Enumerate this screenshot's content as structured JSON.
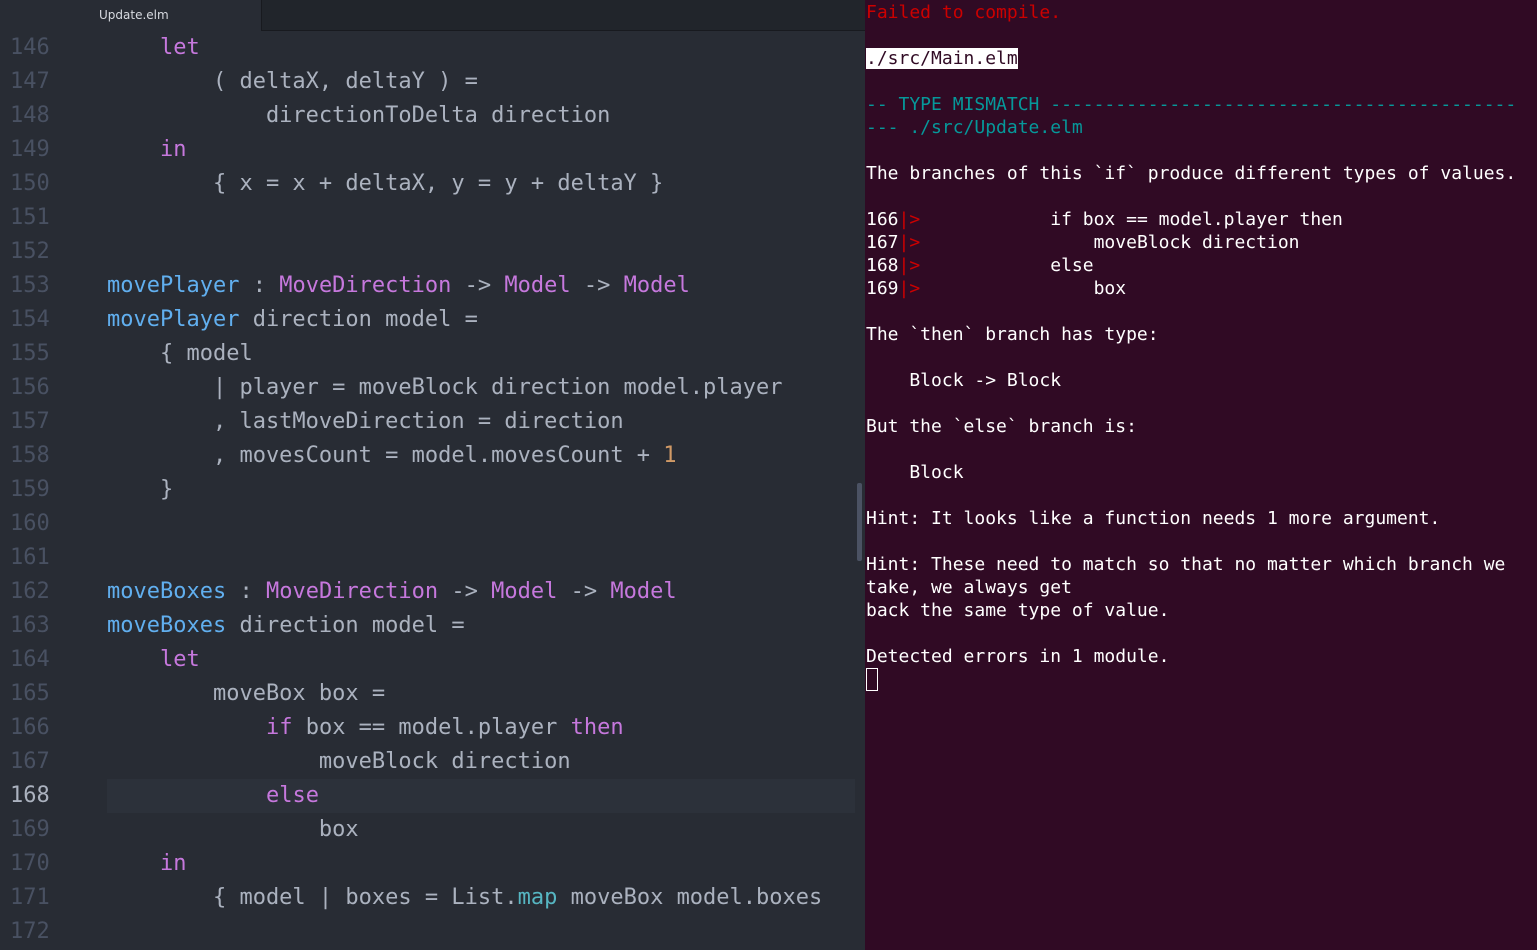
{
  "editor": {
    "tab_title": "Update.elm",
    "active_line": "168",
    "lines": [
      {
        "n": "146",
        "tokens": [
          [
            "    ",
            ""
          ],
          [
            "let",
            "kw"
          ]
        ]
      },
      {
        "n": "147",
        "tokens": [
          [
            "        ( deltaX, deltaY ) =",
            ""
          ]
        ]
      },
      {
        "n": "148",
        "tokens": [
          [
            "            directionToDelta direction",
            ""
          ]
        ]
      },
      {
        "n": "149",
        "tokens": [
          [
            "    ",
            ""
          ],
          [
            "in",
            "kw"
          ]
        ]
      },
      {
        "n": "150",
        "tokens": [
          [
            "        { x = x + deltaX, y = y + deltaY }",
            ""
          ]
        ]
      },
      {
        "n": "151",
        "tokens": []
      },
      {
        "n": "152",
        "tokens": []
      },
      {
        "n": "153",
        "tokens": [
          [
            "movePlayer",
            "fn"
          ],
          [
            " : ",
            "op"
          ],
          [
            "MoveDirection",
            "ty"
          ],
          [
            " -> ",
            "op"
          ],
          [
            "Model",
            "ty"
          ],
          [
            " -> ",
            "op"
          ],
          [
            "Model",
            "ty"
          ]
        ]
      },
      {
        "n": "154",
        "tokens": [
          [
            "movePlayer",
            "fn"
          ],
          [
            " direction model =",
            ""
          ]
        ]
      },
      {
        "n": "155",
        "tokens": [
          [
            "    { model",
            ""
          ]
        ]
      },
      {
        "n": "156",
        "tokens": [
          [
            "        | player = moveBlock direction model.player",
            ""
          ]
        ]
      },
      {
        "n": "157",
        "tokens": [
          [
            "        , lastMoveDirection = direction",
            ""
          ]
        ]
      },
      {
        "n": "158",
        "tokens": [
          [
            "        , movesCount = model.movesCount + ",
            ""
          ],
          [
            "1",
            "num"
          ]
        ]
      },
      {
        "n": "159",
        "tokens": [
          [
            "    }",
            ""
          ]
        ]
      },
      {
        "n": "160",
        "tokens": []
      },
      {
        "n": "161",
        "tokens": []
      },
      {
        "n": "162",
        "tokens": [
          [
            "moveBoxes",
            "fn"
          ],
          [
            " : ",
            "op"
          ],
          [
            "MoveDirection",
            "ty"
          ],
          [
            " -> ",
            "op"
          ],
          [
            "Model",
            "ty"
          ],
          [
            " -> ",
            "op"
          ],
          [
            "Model",
            "ty"
          ]
        ]
      },
      {
        "n": "163",
        "tokens": [
          [
            "moveBoxes",
            "fn"
          ],
          [
            " direction model =",
            ""
          ]
        ]
      },
      {
        "n": "164",
        "tokens": [
          [
            "    ",
            ""
          ],
          [
            "let",
            "kw"
          ]
        ]
      },
      {
        "n": "165",
        "tokens": [
          [
            "        moveBox box =",
            ""
          ]
        ]
      },
      {
        "n": "166",
        "tokens": [
          [
            "            ",
            ""
          ],
          [
            "if",
            "kw"
          ],
          [
            " box == model.player ",
            ""
          ],
          [
            "then",
            "kw"
          ]
        ]
      },
      {
        "n": "167",
        "tokens": [
          [
            "                moveBlock direction",
            ""
          ]
        ]
      },
      {
        "n": "168",
        "tokens": [
          [
            "            ",
            ""
          ],
          [
            "else",
            "kw"
          ]
        ]
      },
      {
        "n": "169",
        "tokens": [
          [
            "                box",
            ""
          ]
        ]
      },
      {
        "n": "170",
        "tokens": [
          [
            "    ",
            ""
          ],
          [
            "in",
            "kw"
          ]
        ]
      },
      {
        "n": "171",
        "tokens": [
          [
            "        { model | boxes = List.",
            ""
          ],
          [
            "map",
            "bi"
          ],
          [
            " moveBox model.boxes",
            ""
          ]
        ]
      },
      {
        "n": "172",
        "tokens": []
      }
    ]
  },
  "terminal": {
    "error_header": "Failed to compile.",
    "file_path": "./src/Main.elm",
    "mismatch_line1": "-- TYPE MISMATCH -------------------------------------------",
    "mismatch_line2": "--- ./src/Update.elm",
    "message": "The branches of this `if` produce different types of values.",
    "code_lines": [
      {
        "n": "166",
        "marker": "|>",
        "code": "            if box == model.player then"
      },
      {
        "n": "167",
        "marker": "|>",
        "code": "                moveBlock direction"
      },
      {
        "n": "168",
        "marker": "|>",
        "code": "            else"
      },
      {
        "n": "169",
        "marker": "|>",
        "code": "                box"
      }
    ],
    "then_label": "The `then` branch has type:",
    "then_type": "    Block -> Block",
    "else_label": "But the `else` branch is:",
    "else_type": "    Block",
    "hint1": "Hint: It looks like a function needs 1 more argument.",
    "hint2_line1": "Hint: These need to match so that no matter which branch we",
    "hint2_line2": "take, we always get",
    "hint2_line3": "back the same type of value.",
    "summary": "Detected errors in 1 module."
  }
}
